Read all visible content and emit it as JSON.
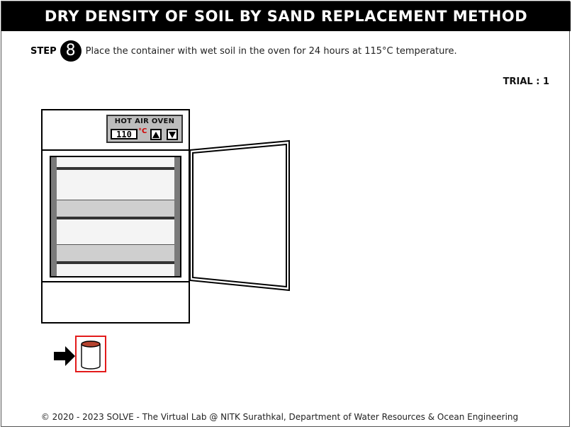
{
  "header": {
    "title": "DRY DENSITY OF SOIL BY SAND REPLACEMENT METHOD"
  },
  "step": {
    "label": "STEP",
    "number": "8",
    "instruction": "Place the container with wet soil in the oven for 24 hours at 115°C temperature."
  },
  "trial": {
    "text": "TRIAL : 1"
  },
  "oven": {
    "panel_title": "HOT AIR OVEN",
    "temperature": "110",
    "unit": "°C",
    "up_icon": "triangle-up-icon",
    "down_icon": "triangle-down-icon",
    "door_state": "open"
  },
  "container": {
    "icon": "container-cylinder-icon",
    "soil_color": "#b5432f",
    "selected": true
  },
  "pointer": {
    "icon": "arrow-right-icon"
  },
  "footer": {
    "text": "© 2020 - 2023 SOLVE - The Virtual Lab @ NITK Surathkal, Department of Water Resources & Ocean Engineering"
  },
  "colors": {
    "header_bg": "#000000",
    "highlight": "#e31b1b",
    "unit": "#d00000"
  }
}
